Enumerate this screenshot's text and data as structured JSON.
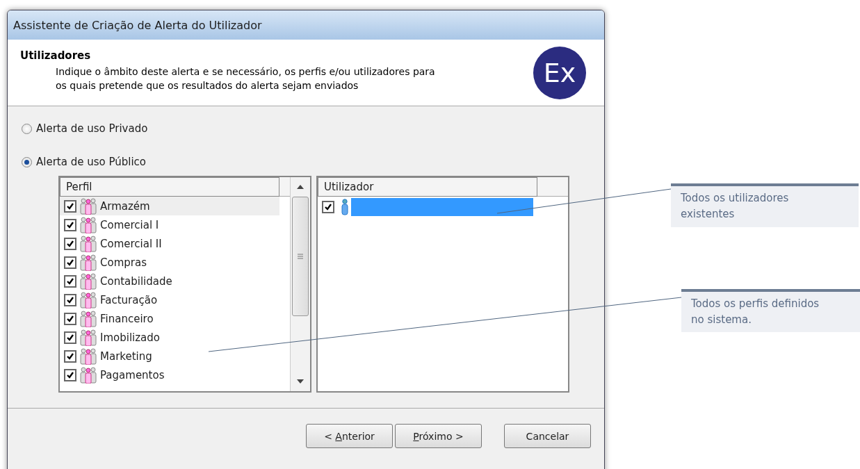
{
  "window": {
    "title": "Assistente de Criação de Alerta do Utilizador"
  },
  "header": {
    "title": "Utilizadores",
    "description": "Indique o âmbito deste alerta e se necessário, os perfis e/ou utilizadores para os quais pretende que os resultados do alerta sejam enviados",
    "logo": "Ex"
  },
  "scope_options": [
    {
      "label": "Alerta de uso Privado",
      "selected": false
    },
    {
      "label": "Alerta de uso Público",
      "selected": true
    }
  ],
  "profiles": {
    "column": "Perfil",
    "items": [
      {
        "name": "Armazém",
        "checked": true,
        "selected": true
      },
      {
        "name": "Comercial I",
        "checked": true,
        "selected": false
      },
      {
        "name": "Comercial II",
        "checked": true,
        "selected": false
      },
      {
        "name": "Compras",
        "checked": true,
        "selected": false
      },
      {
        "name": "Contabilidade",
        "checked": true,
        "selected": false
      },
      {
        "name": "Facturação",
        "checked": true,
        "selected": false
      },
      {
        "name": "Financeiro",
        "checked": true,
        "selected": false
      },
      {
        "name": "Imobilizado",
        "checked": true,
        "selected": false
      },
      {
        "name": "Marketing",
        "checked": true,
        "selected": false
      },
      {
        "name": "Pagamentos",
        "checked": true,
        "selected": false
      }
    ]
  },
  "users": {
    "column": "Utilizador",
    "items": [
      {
        "checked": true,
        "selected": true
      }
    ]
  },
  "buttons": [
    {
      "prefix": "< ",
      "accel": "A",
      "suffix": "nterior"
    },
    {
      "accel": "P",
      "suffix": "róximo >"
    },
    {
      "prefix": "Cancelar"
    }
  ],
  "callouts": [
    {
      "text": "Todos os utilizadores existentes"
    },
    {
      "text": "Todos os perfis definidos no sistema."
    }
  ]
}
